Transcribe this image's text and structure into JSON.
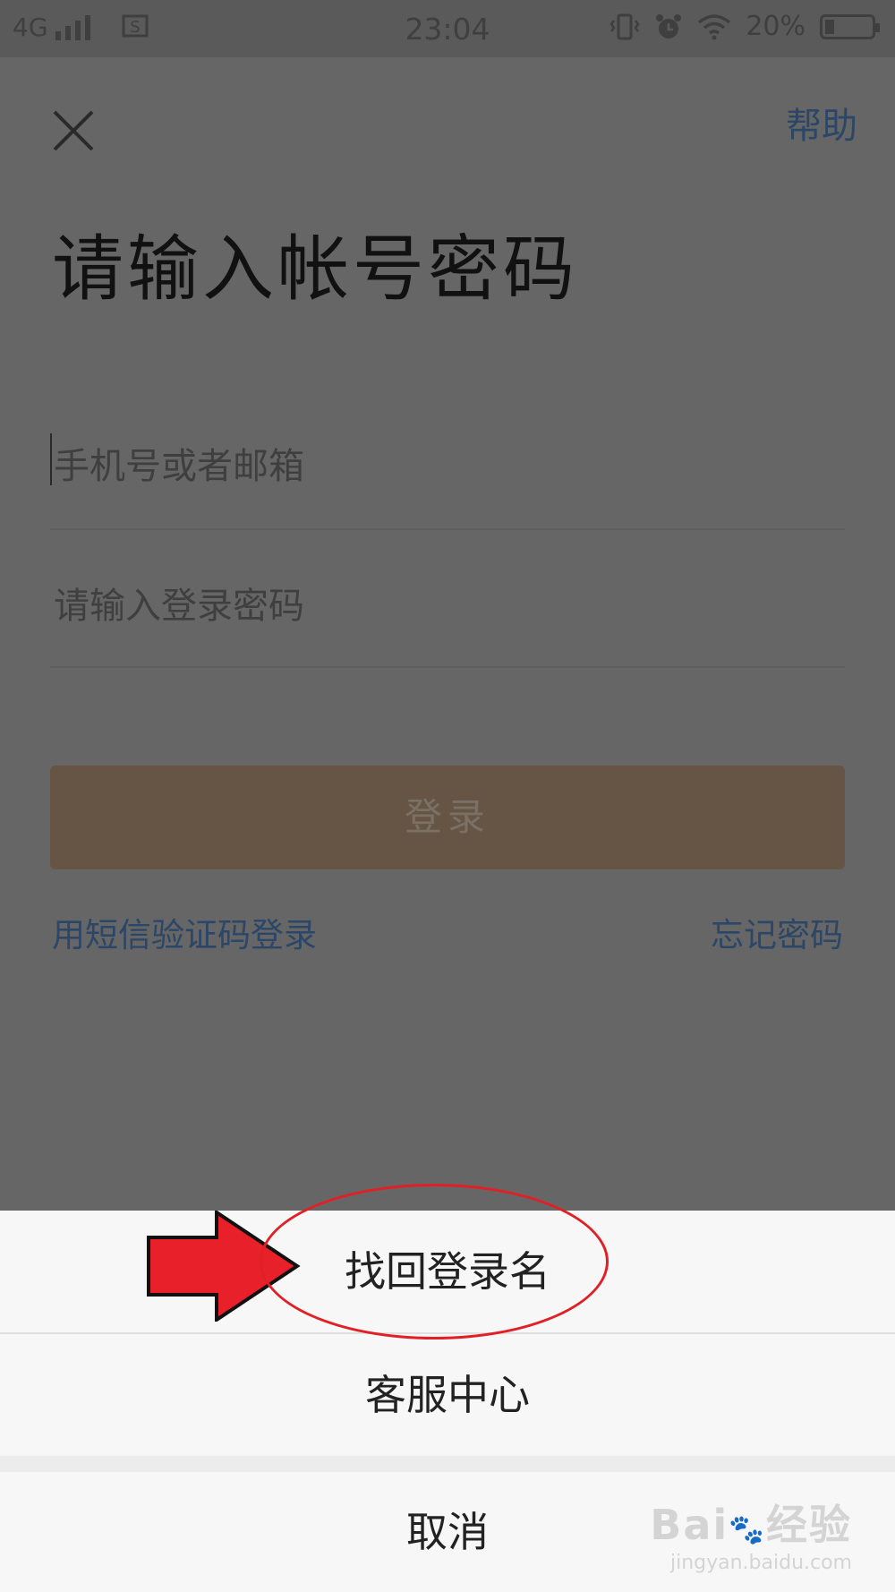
{
  "status_bar": {
    "network": "4G",
    "time": "23:04",
    "battery": "20%",
    "battery_level": 0.2
  },
  "header": {
    "help_label": "帮助"
  },
  "page_title": "请输入帐号密码",
  "form": {
    "account_placeholder": "手机号或者邮箱",
    "password_placeholder": "请输入登录密码",
    "login_label": "登录"
  },
  "links": {
    "sms_login": "用短信验证码登录",
    "forgot_password": "忘记密码"
  },
  "action_sheet": {
    "items": [
      {
        "label": "找回登录名"
      },
      {
        "label": "客服中心"
      }
    ],
    "cancel_label": "取消"
  },
  "watermark": {
    "brand_a": "Bai",
    "brand_paw": "🐾",
    "brand_b": "经验",
    "url": "jingyan.baidu.com"
  },
  "colors": {
    "overlay": "#666666",
    "link": "#2b4666",
    "login_button": "#665444",
    "annotation_red": "#e02025"
  }
}
